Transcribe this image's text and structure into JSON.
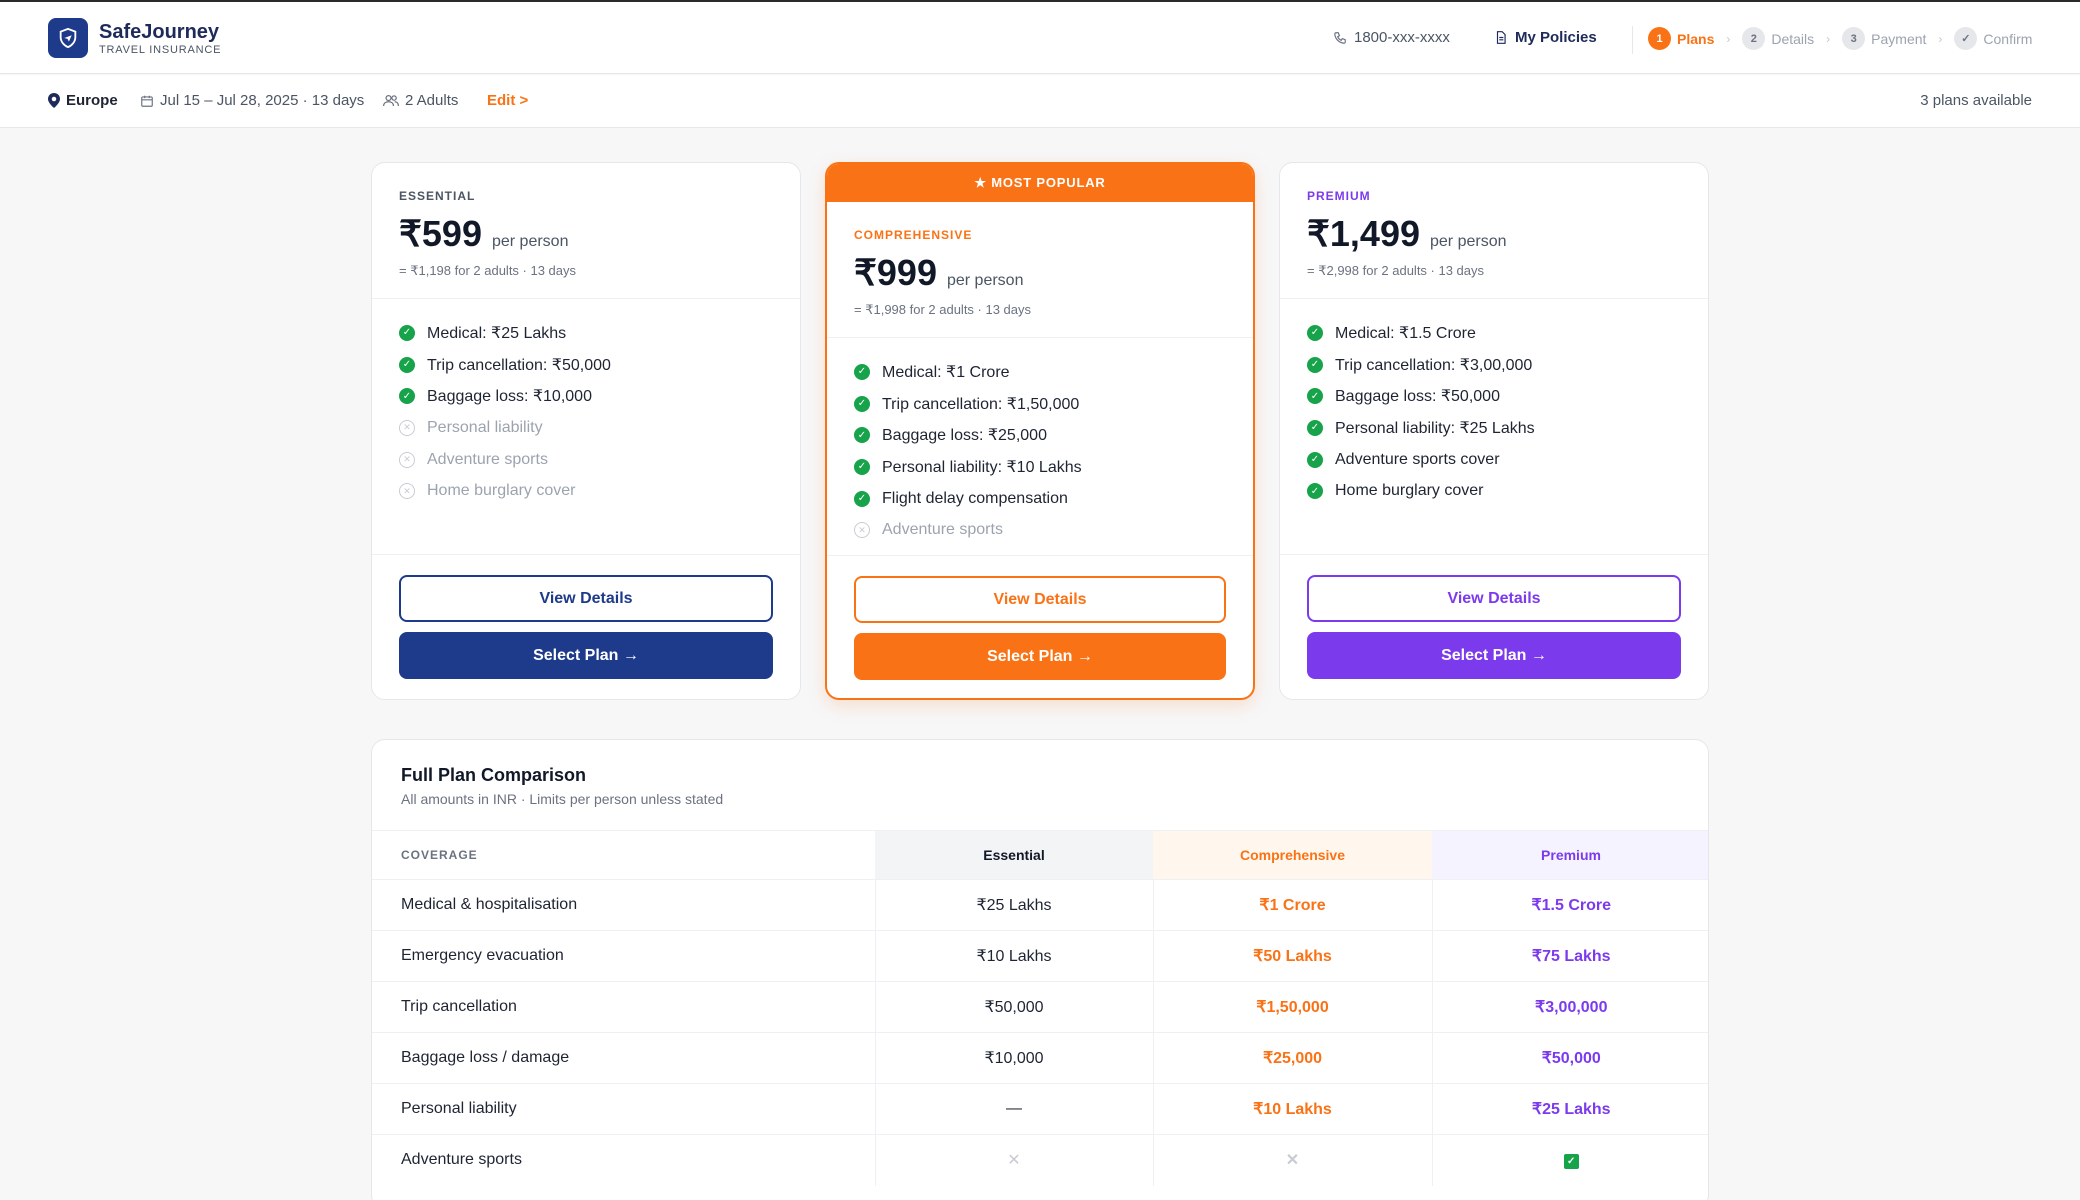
{
  "header": {
    "brand_name": "SafeJourney",
    "brand_sub": "TRAVEL INSURANCE",
    "phone": "1800-xxx-xxxx",
    "my_policies": "My Policies",
    "steps": [
      {
        "num": "1",
        "label": "Plans"
      },
      {
        "num": "2",
        "label": "Details"
      },
      {
        "num": "3",
        "label": "Payment"
      },
      {
        "num": "✓",
        "label": "Confirm"
      }
    ]
  },
  "trip": {
    "destination": "Europe",
    "dates": "Jul 15 – Jul 28, 2025 · 13 days",
    "travellers": "2 Adults",
    "edit": "Edit >",
    "plans_available": "3 plans available"
  },
  "plans": {
    "popular_banner": "★ MOST POPULAR",
    "essential": {
      "tier": "ESSENTIAL",
      "price": "₹599",
      "per": "per person",
      "total": "= ₹1,198 for 2 adults · 13 days",
      "features": [
        {
          "label": "Medical: ₹25 Lakhs",
          "included": true
        },
        {
          "label": "Trip cancellation: ₹50,000",
          "included": true
        },
        {
          "label": "Baggage loss: ₹10,000",
          "included": true
        },
        {
          "label": "Personal liability",
          "included": false
        },
        {
          "label": "Adventure sports",
          "included": false
        },
        {
          "label": "Home burglary cover",
          "included": false
        }
      ],
      "view_details": "View Details",
      "select": "Select Plan →"
    },
    "comprehensive": {
      "tier": "COMPREHENSIVE",
      "price": "₹999",
      "per": "per person",
      "total": "= ₹1,998 for 2 adults · 13 days",
      "features": [
        {
          "label": "Medical: ₹1 Crore",
          "included": true
        },
        {
          "label": "Trip cancellation: ₹1,50,000",
          "included": true
        },
        {
          "label": "Baggage loss: ₹25,000",
          "included": true
        },
        {
          "label": "Personal liability: ₹10 Lakhs",
          "included": true
        },
        {
          "label": "Flight delay compensation",
          "included": true
        },
        {
          "label": "Adventure sports",
          "included": false
        }
      ],
      "view_details": "View Details",
      "select": "Select Plan →"
    },
    "premium": {
      "tier": "PREMIUM",
      "price": "₹1,499",
      "per": "per person",
      "total": "= ₹2,998 for 2 adults · 13 days",
      "features": [
        {
          "label": "Medical: ₹1.5 Crore",
          "included": true
        },
        {
          "label": "Trip cancellation: ₹3,00,000",
          "included": true
        },
        {
          "label": "Baggage loss: ₹50,000",
          "included": true
        },
        {
          "label": "Personal liability: ₹25 Lakhs",
          "included": true
        },
        {
          "label": "Adventure sports cover",
          "included": true
        },
        {
          "label": "Home burglary cover",
          "included": true
        }
      ],
      "view_details": "View Details",
      "select": "Select Plan →"
    }
  },
  "comparison": {
    "title": "Full Plan Comparison",
    "subtitle": "All amounts in INR · Limits per person unless stated",
    "headers": [
      "COVERAGE",
      "Essential",
      "Comprehensive",
      "Premium"
    ],
    "rows": [
      {
        "label": "Medical & hospitalisation",
        "essential": "₹25 Lakhs",
        "comprehensive": "₹1 Crore",
        "premium": "₹1.5 Crore"
      },
      {
        "label": "Emergency evacuation",
        "essential": "₹10 Lakhs",
        "comprehensive": "₹50 Lakhs",
        "premium": "₹75 Lakhs"
      },
      {
        "label": "Trip cancellation",
        "essential": "₹50,000",
        "comprehensive": "₹1,50,000",
        "premium": "₹3,00,000"
      },
      {
        "label": "Baggage loss / damage",
        "essential": "₹10,000",
        "comprehensive": "₹25,000",
        "premium": "₹50,000"
      },
      {
        "label": "Personal liability",
        "essential": "—",
        "comprehensive": "₹10 Lakhs",
        "premium": "₹25 Lakhs"
      },
      {
        "label": "Adventure sports",
        "essential": "✕",
        "comprehensive": "✕",
        "premium": "✓"
      }
    ]
  },
  "colors": {
    "navy": "#1e3a8a",
    "orange": "#f97316",
    "purple": "#7c3aed",
    "green": "#16a34a"
  },
  "icons": [
    "shield-plane-icon",
    "phone-icon",
    "document-icon",
    "location-pin-icon",
    "calendar-icon",
    "users-icon",
    "check-circle-icon",
    "x-circle-icon",
    "star-icon"
  ]
}
